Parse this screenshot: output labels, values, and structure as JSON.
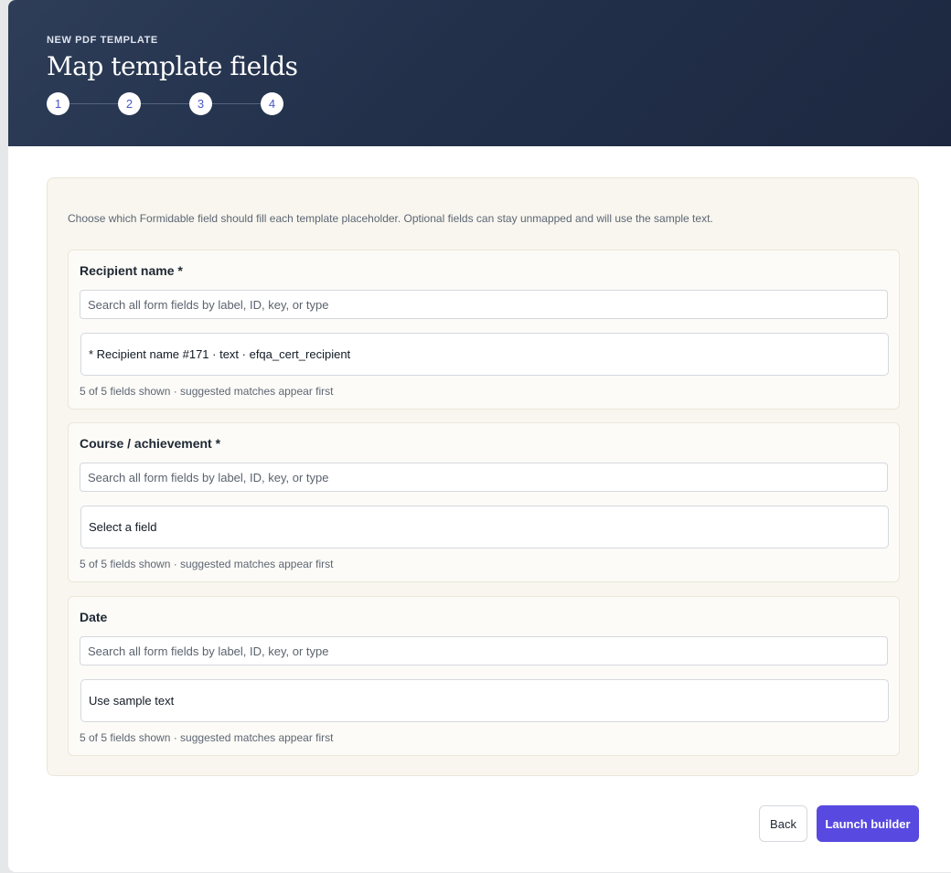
{
  "header": {
    "eyebrow": "NEW PDF TEMPLATE",
    "title": "Map template fields",
    "steps": [
      "1",
      "2",
      "3",
      "4"
    ],
    "current_step": 4
  },
  "panel": {
    "intro": "Choose which Formidable field should fill each template placeholder. Optional fields can stay unmapped and will use the sample text.",
    "fields": [
      {
        "label": "Recipient name *",
        "search_placeholder": "Search all form fields by label, ID, key, or type",
        "selected": "* Recipient name #171 · text · efqa_cert_recipient",
        "hint": "5 of 5 fields shown · suggested matches appear first"
      },
      {
        "label": "Course / achievement *",
        "search_placeholder": "Search all form fields by label, ID, key, or type",
        "selected": "Select a field",
        "hint": "5 of 5 fields shown · suggested matches appear first"
      },
      {
        "label": "Date",
        "search_placeholder": "Search all form fields by label, ID, key, or type",
        "selected": "Use sample text",
        "hint": "5 of 5 fields shown · suggested matches appear first"
      }
    ]
  },
  "footer": {
    "back_label": "Back",
    "launch_label": "Launch builder"
  },
  "colors": {
    "header_bg": "#22304a",
    "accent": "#5849e0",
    "panel_bg": "#f8f6ef"
  }
}
